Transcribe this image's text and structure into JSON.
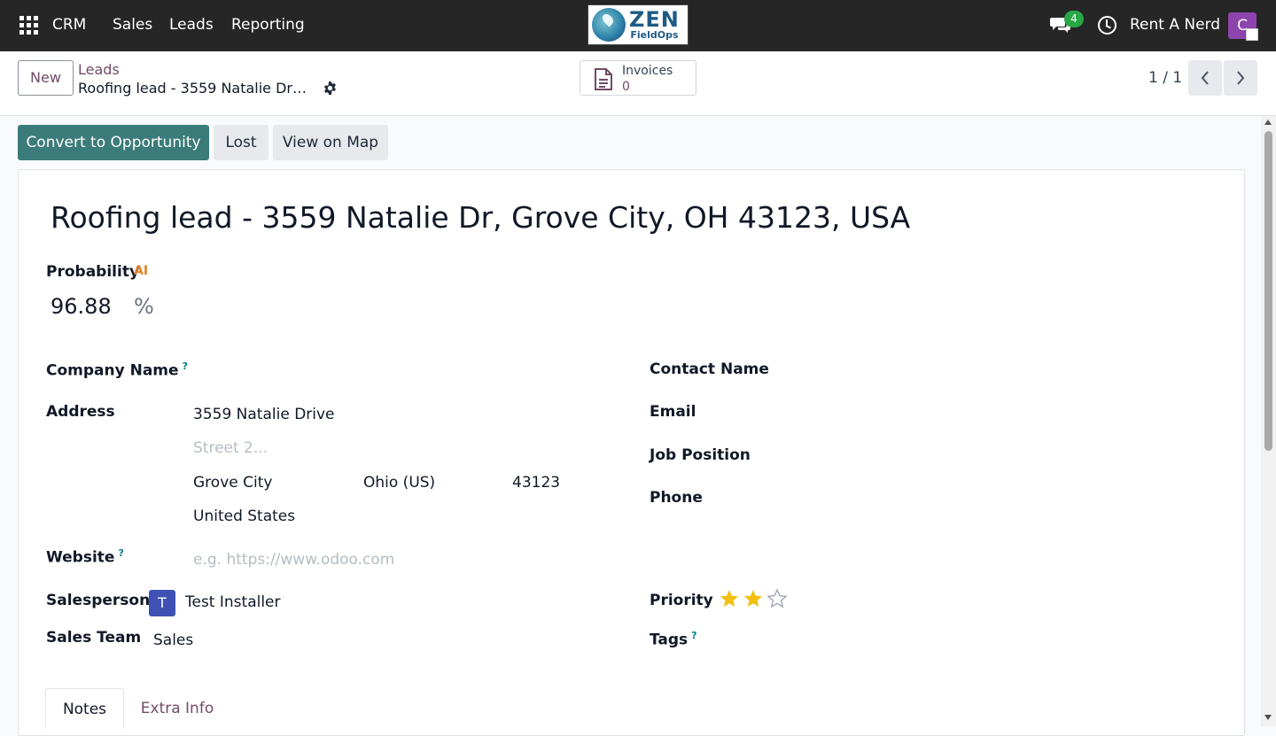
{
  "topbar": {
    "app_name": "CRM",
    "menu": [
      "Sales",
      "Leads",
      "Reporting"
    ],
    "logo": {
      "main": "ZEN",
      "sub": "FieldOps"
    },
    "messages_badge": "4",
    "company": "Rent A Nerd",
    "user_initial": "C"
  },
  "control": {
    "new_label": "New",
    "breadcrumb_parent": "Leads",
    "breadcrumb_current": "Roofing lead - 3559 Natalie Dr, …",
    "invoices_label": "Invoices",
    "invoices_count": "0",
    "pager": "1 / 1"
  },
  "actions": {
    "convert": "Convert to Opportunity",
    "lost": "Lost",
    "map": "View on Map"
  },
  "form": {
    "title": "Roofing lead - 3559 Natalie Dr, Grove City, OH 43123, USA",
    "probability_label": "Probability",
    "ai_badge": "AI",
    "probability_value": "96.88",
    "probability_unit": "%",
    "company_name_label": "Company Name",
    "help_mark": "?",
    "address_label": "Address",
    "street": "3559 Natalie Drive",
    "street2_placeholder": "Street 2...",
    "city": "Grove City",
    "state": "Ohio (US)",
    "zip": "43123",
    "country": "United States",
    "website_label": "Website",
    "website_placeholder": "e.g. https://www.odoo.com",
    "salesperson_label": "Salesperson",
    "salesperson_initial": "T",
    "salesperson_name": "Test Installer",
    "sales_team_label": "Sales Team",
    "sales_team": "Sales",
    "contact_name_label": "Contact Name",
    "email_label": "Email",
    "job_position_label": "Job Position",
    "phone_label": "Phone",
    "priority_label": "Priority",
    "priority_stars_filled": 2,
    "priority_stars_total": 3,
    "tags_label": "Tags"
  },
  "tabs": [
    "Notes",
    "Extra Info"
  ],
  "colors": {
    "topbar": "#262626",
    "primary": "#3b7b7a",
    "link": "#714B67",
    "star": "#f3c00f"
  }
}
